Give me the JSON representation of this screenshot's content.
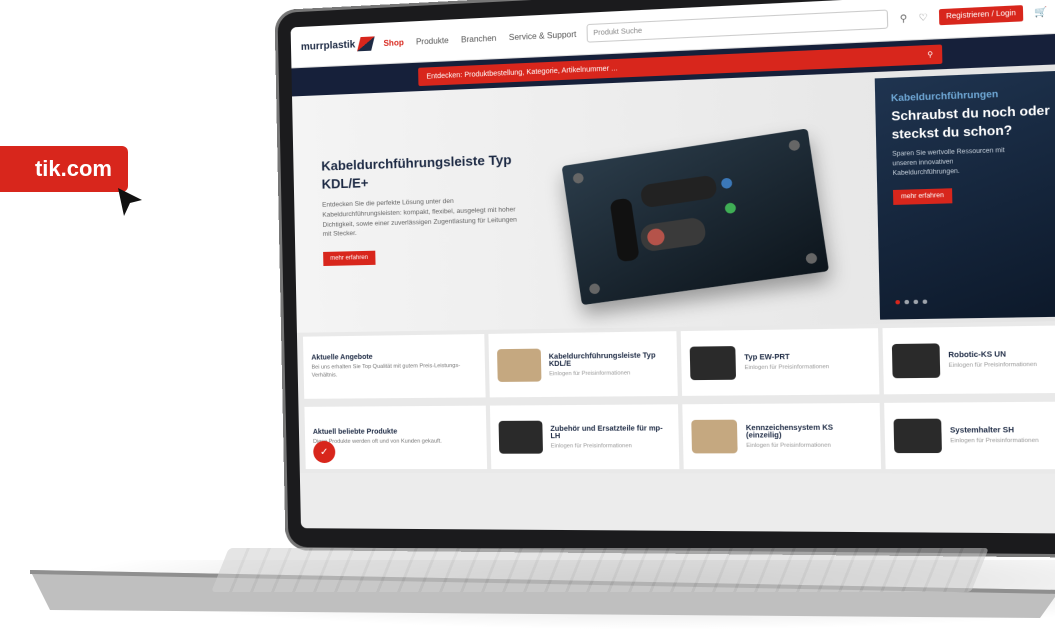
{
  "badge": {
    "url_text": "tik.com"
  },
  "header": {
    "logo_text": "murrplastik",
    "nav": [
      "Shop",
      "Produkte",
      "Branchen",
      "Service & Support"
    ],
    "search_placeholder": "Produkt Suche",
    "login_label": "Registrieren / Login"
  },
  "promo": {
    "text": "Entdecken: Produktbestellung, Kategorie, Artikelnummer ..."
  },
  "hero": {
    "title": "Kabeldurchführungsleiste Typ KDL/E+",
    "description": "Entdecken Sie die perfekte Lösung unter den Kabeldurchführungsleisten: kompakt, flexibel, ausgelegt mit hoher Dichtigkeit, sowie einer zuverlässigen Zugentlastung für Leitungen mit Stecker.",
    "button": "mehr erfahren"
  },
  "side_card": {
    "kicker": "Kabeldurchführungen",
    "title": "Schraubst du noch oder steckst du schon?",
    "description": "Sparen Sie wertvolle Ressourcen mit unseren innovativen Kabeldurchführungen.",
    "button": "mehr erfahren"
  },
  "offers": [
    {
      "title": "Aktuelle Angebote",
      "desc": "Bei uns erhalten Sie Top Qualität mit gutem Preis-Leistungs-Verhältnis."
    },
    {
      "title": "Kabeldurchführungsleiste Typ KDL/E",
      "meta": "Einlogen für Preisinformationen"
    },
    {
      "title": "Typ EW-PRT",
      "meta": "Einlogen für Preisinformationen"
    },
    {
      "title": "Robotic-KS UN",
      "meta": "Einlogen für Preisinformationen"
    }
  ],
  "popular": [
    {
      "title": "Aktuell beliebte Produkte",
      "desc": "Diese Produkte werden oft und von Kunden gekauft."
    },
    {
      "title": "Zubehör und Ersatzteile für mp-LH",
      "meta": "Einlogen für Preisinformationen"
    },
    {
      "title": "Kennzeichensystem KS (einzeilig)",
      "meta": "Einlogen für Preisinformationen"
    },
    {
      "title": "Systemhalter SH",
      "meta": "Einlogen für Preisinformationen"
    }
  ]
}
